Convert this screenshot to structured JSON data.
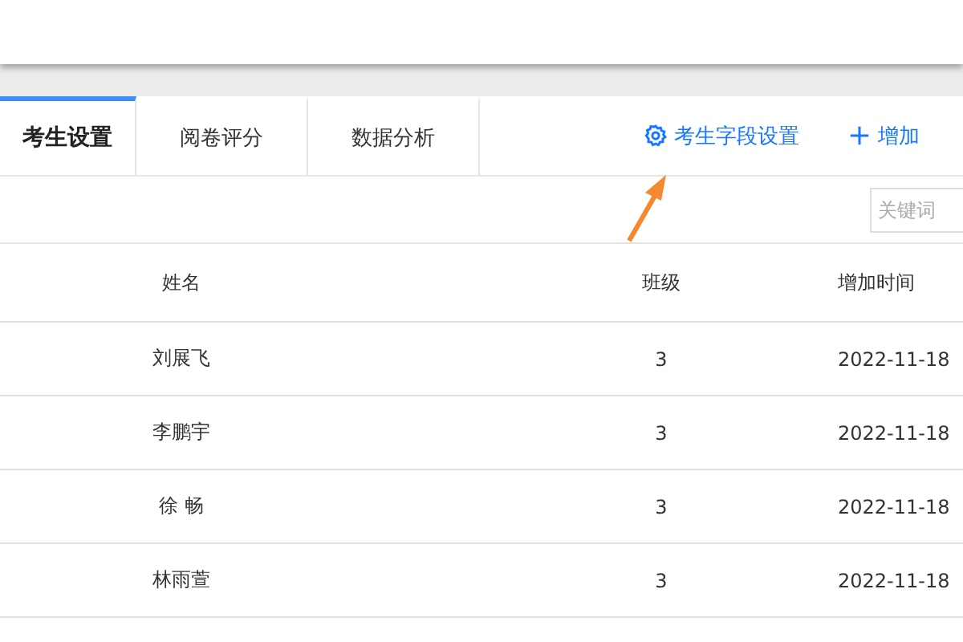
{
  "tabs": [
    {
      "label": "考生设置",
      "selected": true
    },
    {
      "label": "阅卷评分",
      "selected": false
    },
    {
      "label": "数据分析",
      "selected": false
    }
  ],
  "actions": [
    {
      "kind": "settings",
      "label": "考生字段设置"
    },
    {
      "kind": "add",
      "label": "增加"
    }
  ],
  "search": {
    "placeholder": "关键词"
  },
  "table": {
    "columns": [
      "姓名",
      "班级",
      "增加时间"
    ],
    "rows": [
      [
        "刘展飞",
        "3",
        "2022-11-18"
      ],
      [
        "李鹏宇",
        "3",
        "2022-11-18"
      ],
      [
        "徐 畅",
        "3",
        "2022-11-18"
      ],
      [
        "林雨萱",
        "3",
        "2022-11-18"
      ]
    ]
  }
}
